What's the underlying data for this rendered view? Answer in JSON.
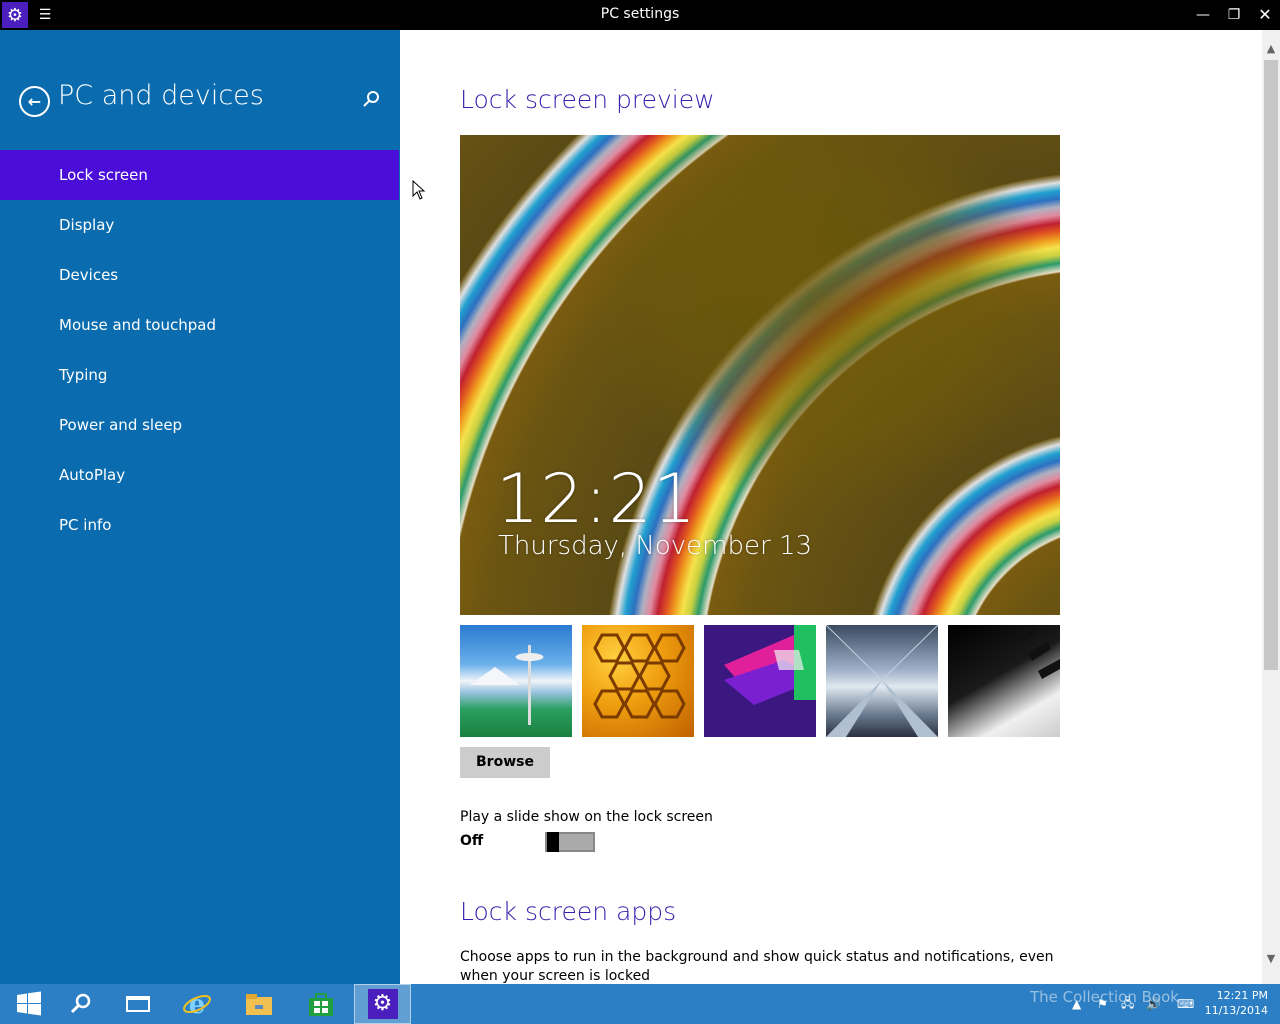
{
  "window": {
    "title": "PC settings",
    "menu_icon": "hamburger-icon",
    "app_icon": "gear-icon"
  },
  "sidebar": {
    "title": "PC and devices",
    "items": [
      {
        "label": "Lock screen",
        "active": true
      },
      {
        "label": "Display"
      },
      {
        "label": "Devices"
      },
      {
        "label": "Mouse and touchpad"
      },
      {
        "label": "Typing"
      },
      {
        "label": "Power and sleep"
      },
      {
        "label": "AutoPlay"
      },
      {
        "label": "PC info"
      }
    ]
  },
  "main": {
    "preview_heading": "Lock screen preview",
    "preview_time": "12:21",
    "preview_date": "Thursday, November 13",
    "browse_label": "Browse",
    "slideshow_label": "Play a slide show on the lock screen",
    "slideshow_state": "Off",
    "apps_heading": "Lock screen apps",
    "apps_description": "Choose apps to run in the background and show quick status and notifications, even when your screen is locked"
  },
  "taskbar": {
    "clock_time": "12:21 PM",
    "clock_date": "11/13/2014",
    "watermark": "The Collection Book"
  },
  "colors": {
    "sidebar_bg": "#0a6cae",
    "active_item": "#4b0ed9",
    "heading": "#3a1dae",
    "taskbar": "#2c7fc4"
  }
}
